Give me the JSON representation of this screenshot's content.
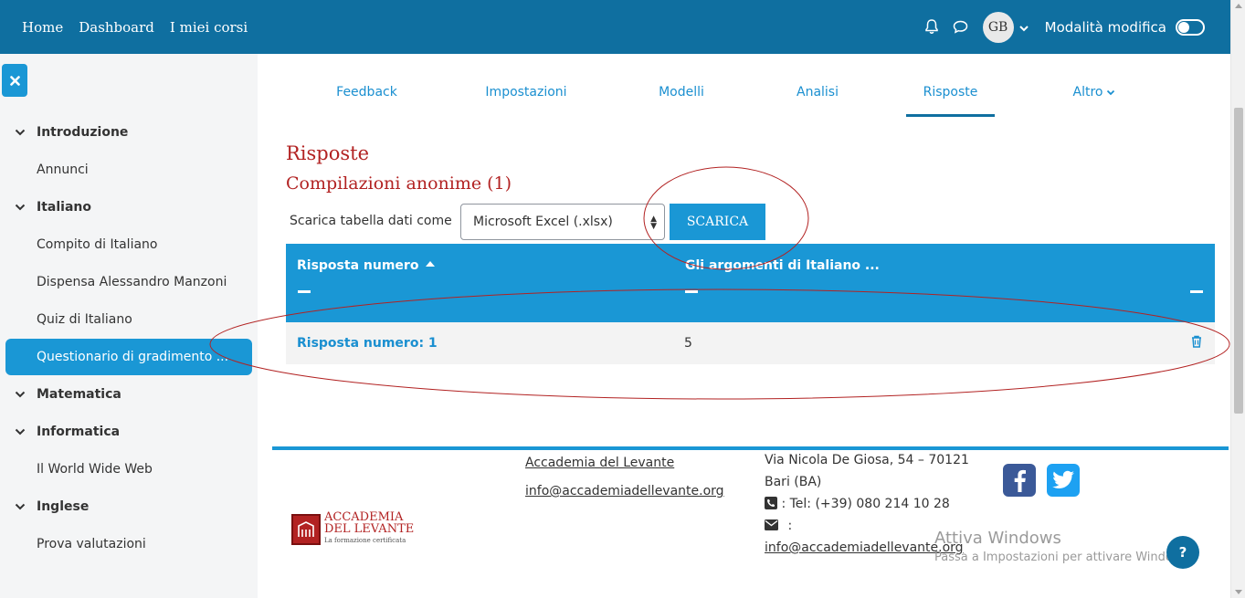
{
  "navbar": {
    "links": [
      "Home",
      "Dashboard",
      "I miei corsi"
    ],
    "avatar_initials": "GB",
    "edit_mode_label": "Modalità modifica",
    "color": "#0f6fa0"
  },
  "sidebar": {
    "close_icon": "close-icon",
    "items": [
      {
        "label": "Introduzione",
        "type": "section"
      },
      {
        "label": "Annunci",
        "type": "leaf"
      },
      {
        "label": "Italiano",
        "type": "section"
      },
      {
        "label": "Compito di Italiano",
        "type": "leaf"
      },
      {
        "label": "Dispensa Alessandro Manzoni",
        "type": "leaf"
      },
      {
        "label": "Quiz di Italiano",
        "type": "leaf"
      },
      {
        "label": "Questionario di gradimento ...",
        "type": "leaf",
        "active": true
      },
      {
        "label": "Matematica",
        "type": "section"
      },
      {
        "label": "Informatica",
        "type": "section"
      },
      {
        "label": "Il World Wide Web",
        "type": "leaf"
      },
      {
        "label": "Inglese",
        "type": "section"
      },
      {
        "label": "Prova valutazioni",
        "type": "leaf"
      }
    ]
  },
  "tabs": [
    {
      "label": "Feedback"
    },
    {
      "label": "Impostazioni"
    },
    {
      "label": "Modelli"
    },
    {
      "label": "Analisi"
    },
    {
      "label": "Risposte",
      "active": true
    },
    {
      "label": "Altro"
    }
  ],
  "main": {
    "title": "Risposte",
    "subtitle": "Compilazioni anonime (1)",
    "download_label": "Scarica tabella dati come",
    "download_format": "Microsoft Excel (.xlsx)",
    "download_button": "SCARICA"
  },
  "table": {
    "headers": [
      "Risposta numero",
      "Gli argomenti di Italiano ..."
    ],
    "rows": [
      {
        "response": "Risposta numero: 1",
        "value": "5"
      }
    ]
  },
  "footer": {
    "org_name": "Accademia del Levante",
    "email": "info@accademiadellevante.org",
    "address_line1": "Via Nicola De Giosa, 54 – 70121",
    "address_line2": "Bari (BA)",
    "phone": ": Tel: (+39) 080 214 10 28",
    "email_colon": ":",
    "email2": "info@accademiadellevante.org",
    "logo_line1": "ACCADEMIA",
    "logo_line2": "DEL LEVANTE",
    "logo_line3": "La formazione certificata"
  },
  "watermark": {
    "line1": "Attiva Windows",
    "line2": "Passa a Impostazioni per attivare Windows."
  },
  "help_label": "?"
}
